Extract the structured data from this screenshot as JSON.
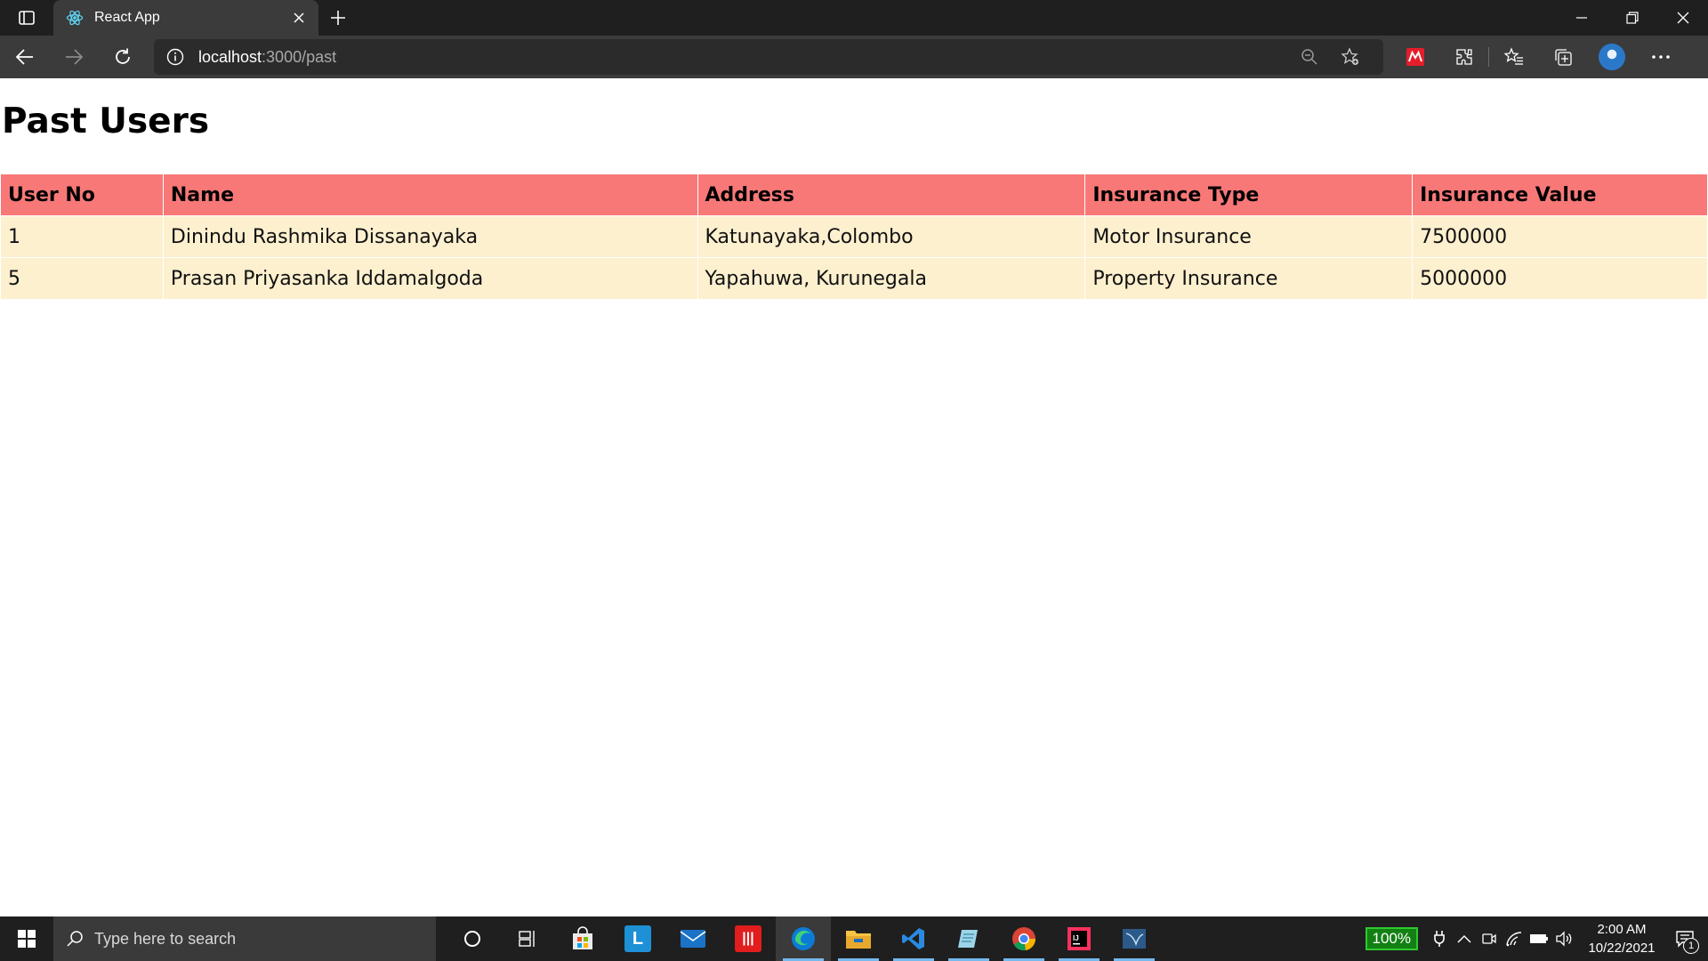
{
  "browser": {
    "tab_title": "React App",
    "url_host": "localhost",
    "url_path": ":3000/past"
  },
  "page": {
    "title": "Past Users",
    "table": {
      "headers": [
        "User No",
        "Name",
        "Address",
        "Insurance Type",
        "Insurance Value"
      ],
      "rows": [
        [
          "1",
          "Dinindu Rashmika Dissanayaka",
          "Katunayaka,Colombo",
          "Motor Insurance",
          "7500000"
        ],
        [
          "5",
          "Prasan Priyasanka Iddamalgoda",
          "Yapahuwa, Kurunegala",
          "Property Insurance",
          "5000000"
        ]
      ]
    },
    "colors": {
      "header_bg": "#f87878",
      "row_bg": "#fdf0cf"
    }
  },
  "taskbar": {
    "search_placeholder": "Type here to search",
    "battery": "100%",
    "time": "2:00 AM",
    "date": "10/22/2021",
    "notification_count": "1",
    "apps": [
      "cortana-icon",
      "task-view-icon",
      "store-icon",
      "l-app-icon",
      "mail-icon",
      "red-app-icon",
      "edge-icon",
      "file-explorer-icon",
      "vscode-icon",
      "notepad-icon",
      "chrome-icon",
      "intellij-icon",
      "sql-server-icon"
    ]
  }
}
